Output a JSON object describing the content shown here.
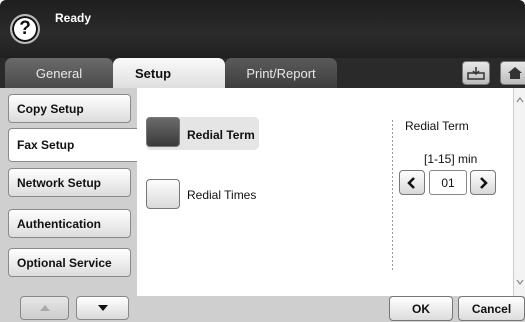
{
  "status": {
    "text": "Ready",
    "help_symbol": "?"
  },
  "tabs": [
    {
      "label": "General"
    },
    {
      "label": "Setup"
    },
    {
      "label": "Print/Report"
    }
  ],
  "sidebar": {
    "items": [
      {
        "label": "Copy Setup"
      },
      {
        "label": "Fax Setup"
      },
      {
        "label": "Network Setup"
      },
      {
        "label": "Authentication"
      },
      {
        "label": "Optional Service"
      }
    ],
    "active": "Fax Setup"
  },
  "options": [
    {
      "label": "Redial Term",
      "selected": true
    },
    {
      "label": "Redial Times",
      "selected": false
    }
  ],
  "detail": {
    "title": "Redial Term",
    "range": "[1-15] min",
    "value": "01"
  },
  "actions": {
    "ok": "OK",
    "cancel": "Cancel"
  },
  "icons": [
    "help-icon",
    "tray-icon",
    "home-icon",
    "arrow-left-icon",
    "arrow-right-icon",
    "arrow-up-icon",
    "arrow-down-icon"
  ],
  "colors": {
    "header": "#202020",
    "panel": "#cfcfcf",
    "selected": "#3a3a3a"
  }
}
